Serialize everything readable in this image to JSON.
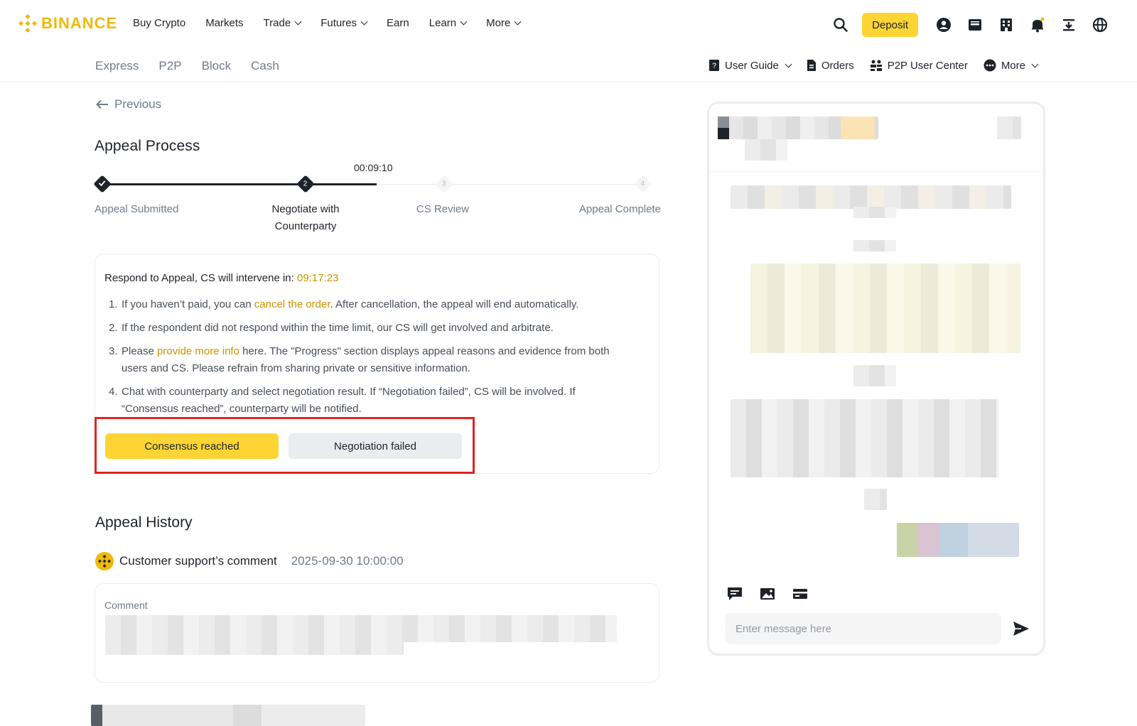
{
  "brand": {
    "name": "BINANCE",
    "color": "#f0b90b"
  },
  "nav": {
    "items": [
      {
        "label": "Buy Crypto",
        "dropdown": false
      },
      {
        "label": "Markets",
        "dropdown": false
      },
      {
        "label": "Trade",
        "dropdown": true
      },
      {
        "label": "Futures",
        "dropdown": true
      },
      {
        "label": "Earn",
        "dropdown": false
      },
      {
        "label": "Learn",
        "dropdown": true
      },
      {
        "label": "More",
        "dropdown": true
      }
    ],
    "deposit_label": "Deposit",
    "icons": [
      "search-icon",
      "user-icon",
      "wallet-icon",
      "orders-icon",
      "bell-icon",
      "download-icon",
      "globe-icon"
    ]
  },
  "subnav": {
    "tabs": [
      "Express",
      "P2P",
      "Block",
      "Cash"
    ],
    "right": {
      "user_guide": "User Guide",
      "orders": "Orders",
      "user_center": "P2P User Center",
      "more": "More"
    }
  },
  "back_label": "Previous",
  "appeal": {
    "title": "Appeal Process",
    "timer": "00:09:10",
    "steps": [
      {
        "num": "1",
        "label": "Appeal Submitted",
        "state": "done"
      },
      {
        "num": "2",
        "label": "Negotiate with Counterparty",
        "state": "current"
      },
      {
        "num": "3",
        "label": "CS Review",
        "state": "todo"
      },
      {
        "num": "4",
        "label": "Appeal Complete",
        "state": "todo"
      }
    ],
    "progress_fraction": 0.5
  },
  "respond": {
    "heading": "Respond to Appeal, CS will intervene in:",
    "countdown": "09:17:23",
    "items": [
      {
        "n": "1.",
        "pre": " If you haven’t paid, you can ",
        "link": "cancel the order",
        "post": ". After cancellation, the appeal will end automatically."
      },
      {
        "n": "2.",
        "pre": "If the respondent did not respond within the time limit, our CS will get involved and arbitrate.",
        "link": "",
        "post": ""
      },
      {
        "n": "3.",
        "pre": "Please ",
        "link": "provide more info",
        "post": " here. The \"Progress\" section displays appeal reasons and evidence from both users and CS. Please refrain from sharing private or sensitive information."
      },
      {
        "n": "4.",
        "pre": "Chat with counterparty and select negotiation result. If “Negotiation failed”, CS will be involved. If “Consensus reached”, counterparty will be notified.",
        "link": "",
        "post": ""
      }
    ],
    "consensus_label": "Consensus reached",
    "failed_label": "Negotiation failed",
    "highlight_color": "#e02424"
  },
  "history": {
    "title": "Appeal History",
    "author": "Customer support’s comment",
    "time": "2025-09-30 10:00:00",
    "comment_label": "Comment"
  },
  "chat": {
    "placeholder": "Enter message here",
    "tool_icons": [
      "message-icon",
      "image-icon",
      "card-icon"
    ]
  }
}
